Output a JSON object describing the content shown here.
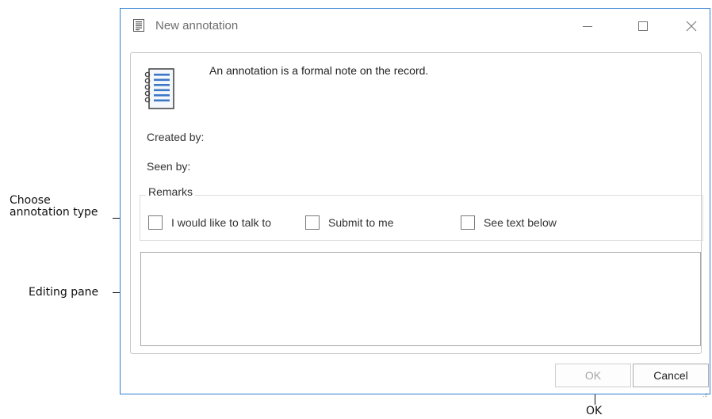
{
  "window": {
    "title": "New annotation",
    "intro_text": "An annotation is a formal note on the record.",
    "created_by_label": "Created by:",
    "seen_by_label": "Seen by:",
    "remarks_label": "Remarks",
    "remark_options": [
      {
        "label": "I would like to talk to",
        "checked": false
      },
      {
        "label": "Submit to me",
        "checked": false
      },
      {
        "label": "See text below",
        "checked": false
      }
    ],
    "editor_text": "",
    "buttons": {
      "ok": "OK",
      "cancel": "Cancel"
    }
  },
  "callouts": {
    "annotation_type_line1": "Choose",
    "annotation_type_line2": "annotation type",
    "editing_pane": "Editing pane",
    "ok": "OK"
  },
  "icons": {
    "app": "notepad-icon",
    "minimize": "minimize-icon",
    "maximize": "maximize-icon",
    "close": "close-icon",
    "header": "notebook-icon"
  },
  "colors": {
    "window_border": "#2f7fd3",
    "icon_blue": "#3d78c6",
    "disabled_text": "#a5a5a5"
  }
}
